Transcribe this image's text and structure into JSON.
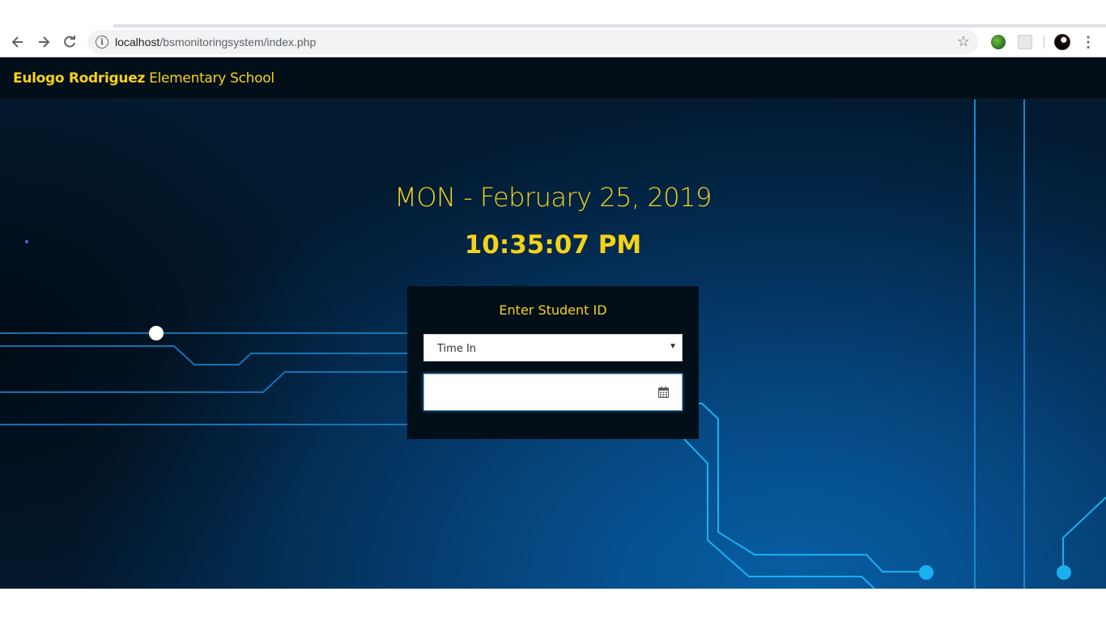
{
  "browser": {
    "url_host": "localhost",
    "url_path": "/bsmonitoringsystem/index.php",
    "icons": [
      "back-arrow-icon",
      "forward-arrow-icon",
      "reload-icon",
      "info-icon",
      "star-icon",
      "extension-globe-icon",
      "extension-icon",
      "avatar",
      "menu-dots-icon"
    ]
  },
  "site": {
    "brand_bold": "Eulogo Rodriguez",
    "brand_rest": " Elementary School"
  },
  "clock": {
    "date": "MON - February 25, 2019",
    "time": "10:35:07 PM"
  },
  "form": {
    "title": "Enter Student ID",
    "mode_selected": "Time In",
    "student_id_value": "",
    "icons": [
      "caret-down-icon",
      "calendar-icon"
    ]
  },
  "colors": {
    "accent_yellow": "#f5d21a",
    "navbar_bg": "#020e18",
    "circuit_cyan": "#1ab0f0"
  }
}
